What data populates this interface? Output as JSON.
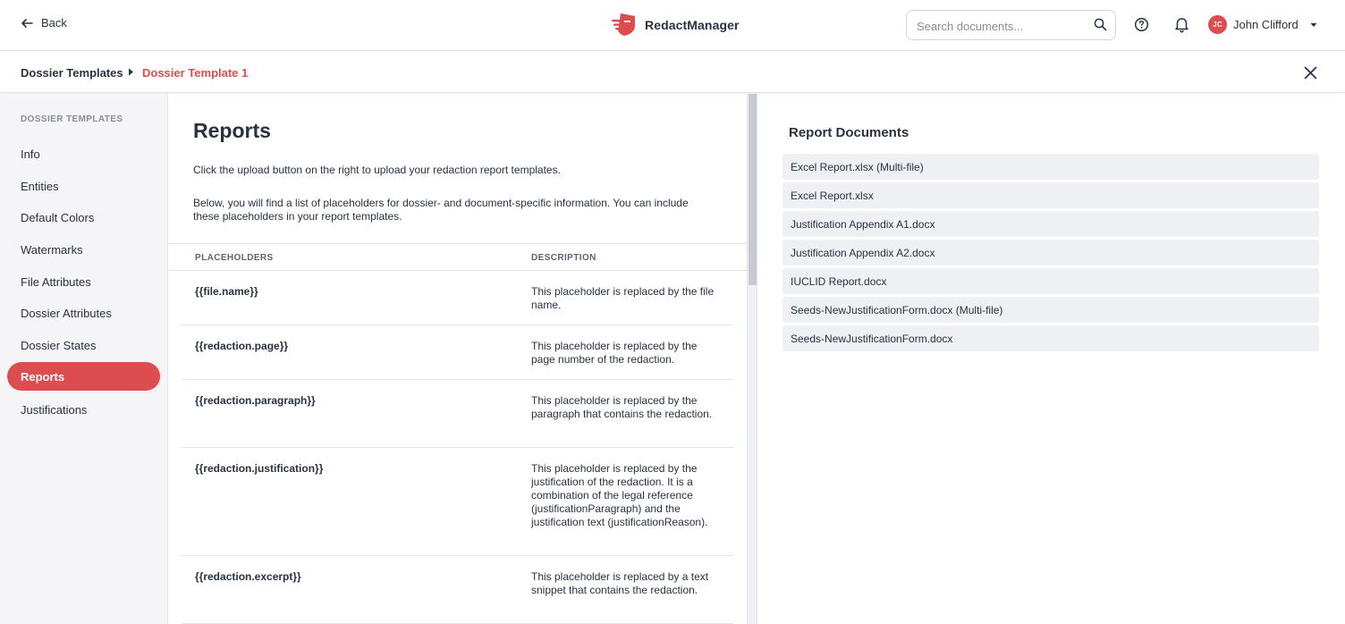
{
  "header": {
    "back_label": "Back",
    "brand_name": "RedactManager",
    "search_placeholder": "Search documents...",
    "user_initials": "JC",
    "user_name": "John Clifford"
  },
  "breadcrumb": {
    "parent": "Dossier Templates",
    "current": "Dossier Template 1"
  },
  "sidebar": {
    "heading": "DOSSIER TEMPLATES",
    "items": [
      {
        "label": "Info"
      },
      {
        "label": "Entities"
      },
      {
        "label": "Default Colors"
      },
      {
        "label": "Watermarks"
      },
      {
        "label": "File Attributes"
      },
      {
        "label": "Dossier Attributes"
      },
      {
        "label": "Dossier States"
      },
      {
        "label": "Reports",
        "active": true
      },
      {
        "label": "Justifications"
      }
    ]
  },
  "main": {
    "title": "Reports",
    "intro1": "Click the upload button on the right to upload your redaction report templates.",
    "intro2": "Below, you will find a list of placeholders for dossier- and document-specific information. You can include these placeholders in your report templates.",
    "table": {
      "col_placeholders": "PLACEHOLDERS",
      "col_description": "DESCRIPTION",
      "rows": [
        {
          "placeholder": "{{file.name}}",
          "description": "This placeholder is replaced by the file name."
        },
        {
          "placeholder": "{{redaction.page}}",
          "description": "This placeholder is replaced by the page number of the redaction."
        },
        {
          "placeholder": "{{redaction.paragraph}}",
          "description": "This placeholder is replaced by the paragraph that contains the redaction."
        },
        {
          "placeholder": "{{redaction.justification}}",
          "description": "This placeholder is replaced by the justification of the redaction. It is a combination of the legal reference (justificationParagraph) and the justification text (justificationReason)."
        },
        {
          "placeholder": "{{redaction.excerpt}}",
          "description": "This placeholder is replaced by a text snippet that contains the redaction."
        }
      ]
    }
  },
  "report_documents": {
    "title": "Report Documents",
    "items": [
      "Excel Report.xlsx (Multi-file)",
      "Excel Report.xlsx",
      "Justification Appendix A1.docx",
      "Justification Appendix A2.docx",
      "IUCLID Report.docx",
      "Seeds-NewJustificationForm.docx (Multi-file)",
      "Seeds-NewJustificationForm.docx"
    ]
  },
  "colors": {
    "accent": "#dd4d50",
    "text": "#283241",
    "sidebar_bg": "#f5f5f7",
    "doc_row_bg": "#eef0f4"
  },
  "icons": [
    "arrow-left-icon",
    "logo-icon",
    "search-icon",
    "help-icon",
    "bell-icon",
    "caret-down-icon",
    "caret-right-icon",
    "close-icon"
  ]
}
